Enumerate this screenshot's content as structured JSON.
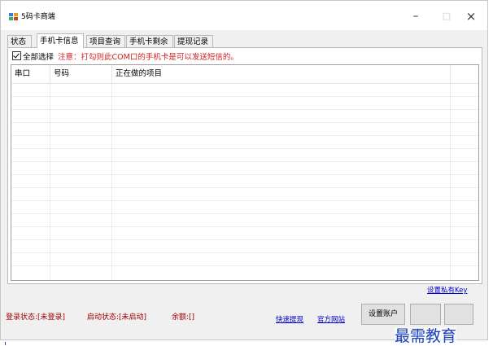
{
  "window": {
    "title": "5码卡商端",
    "app_icon": "app-window-icon",
    "controls": {
      "minimize": "–",
      "maximize": "□",
      "close": "×"
    }
  },
  "tabs": [
    {
      "label": "状态",
      "active": false
    },
    {
      "label": "手机卡信息",
      "active": true
    },
    {
      "label": "项目查询",
      "active": false
    },
    {
      "label": "手机卡剩余",
      "active": false
    },
    {
      "label": "提现记录",
      "active": false
    }
  ],
  "panel": {
    "select_all_label": "全部选择",
    "select_all_checked": true,
    "notice": "注意：打勾则此COM口的手机卡是可以发送短信的。"
  },
  "grid": {
    "columns": [
      "串口",
      "号码",
      "正在做的项目"
    ],
    "rows": []
  },
  "footer": {
    "set_private_key": "设置私有Key",
    "login_status": "登录状态:[未登录]",
    "start_status": "启动状态:[未启动]",
    "balance": "余额:[]",
    "quick_withdraw": "快速提现",
    "official_site": "官方网站",
    "set_account_button": "设置账户",
    "button2": "",
    "button3": ""
  },
  "watermark": "最需教育",
  "colors": {
    "notice_red": "#d02020",
    "status_red": "#a00000",
    "link_blue": "#0000cc",
    "watermark_blue": "#1a3fbf"
  }
}
